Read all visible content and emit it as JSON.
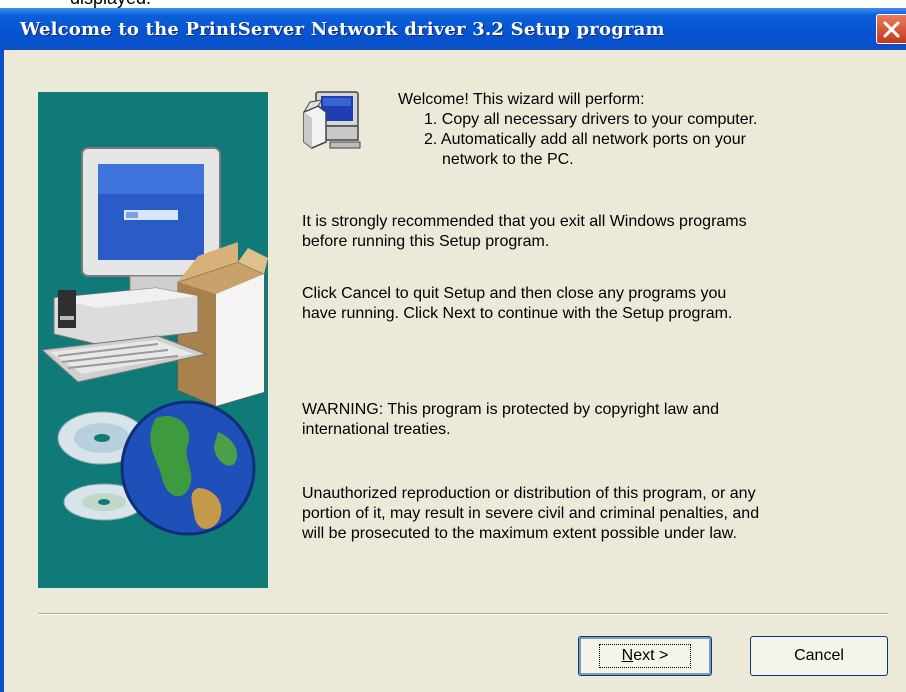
{
  "caption_fragment": "displayed.",
  "window": {
    "title": "Welcome to the PrintServer Network driver 3.2 Setup program"
  },
  "content": {
    "intro": "Welcome!  This wizard will perform:",
    "step1": "1. Copy all necessary drivers to your computer.",
    "step2_line1": "2. Automatically add all network ports on your",
    "step2_line2": "network to the PC.",
    "recommend_line1": "It is strongly recommended that you exit all Windows programs",
    "recommend_line2": "before running this Setup program.",
    "cancel_line1": "Click Cancel to quit Setup and then close any programs you",
    "cancel_line2": "have running.  Click Next to continue with the Setup program.",
    "warning_line1": "WARNING: This program is protected by copyright law and",
    "warning_line2": "international treaties.",
    "unauth_line1": "Unauthorized reproduction or distribution of this program, or any",
    "unauth_line2": "portion of it, may result in severe civil and criminal penalties, and",
    "unauth_line3": "will be prosecuted to the maximum extent possible under law."
  },
  "buttons": {
    "next_mnemonic": "N",
    "next_rest": "ext >",
    "cancel": "Cancel"
  },
  "colors": {
    "titlebar": "#0653d2",
    "banner": "#107a78",
    "dialog_bg": "#ece9d8",
    "close_button": "#c4391c"
  }
}
